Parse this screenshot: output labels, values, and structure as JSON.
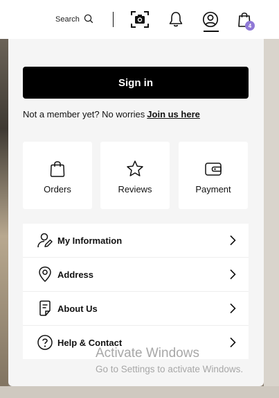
{
  "header": {
    "search_label": "Search",
    "icons": [
      "search-icon",
      "camera-icon",
      "bell-icon",
      "user-icon",
      "shopping-bag-icon"
    ],
    "cart_badge": "4",
    "accent_color": "#8f78d6"
  },
  "account_menu": {
    "sign_in_label": "Sign in",
    "member_prompt": "Not a member yet? No worries",
    "join_link": "Join us here",
    "tiles": [
      {
        "label": "Orders",
        "icon": "shopping-bag-icon"
      },
      {
        "label": "Reviews",
        "icon": "star-icon"
      },
      {
        "label": "Payment",
        "icon": "wallet-icon"
      }
    ],
    "items": [
      {
        "label": "My Information",
        "icon": "user-edit-icon"
      },
      {
        "label": "Address",
        "icon": "location-pin-icon"
      },
      {
        "label": "About Us",
        "icon": "document-icon"
      },
      {
        "label": "Help & Contact",
        "icon": "help-circle-icon"
      }
    ]
  },
  "watermark": {
    "line1": "Activate Windows",
    "line2": "Go to Settings to activate Windows."
  }
}
